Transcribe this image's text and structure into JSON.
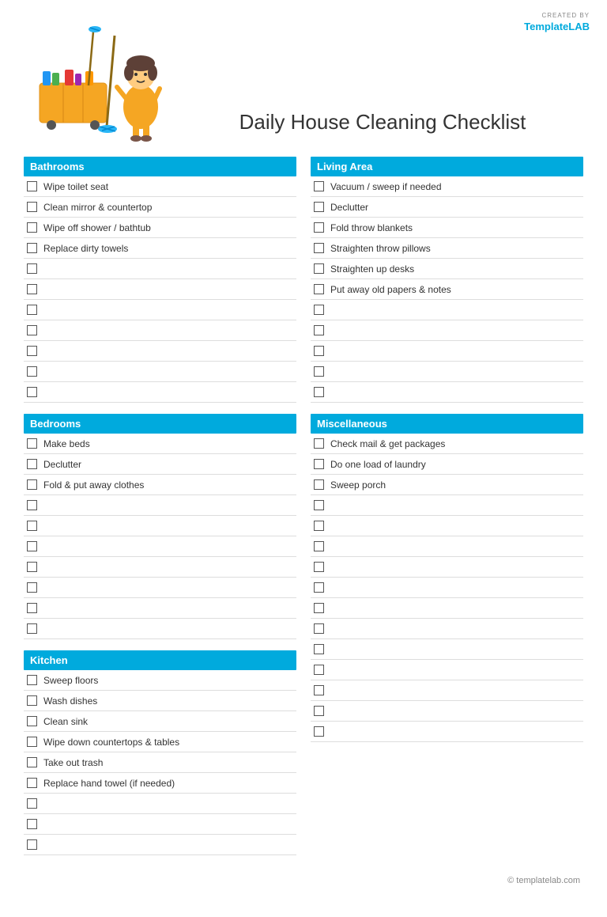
{
  "logo": {
    "created_by": "CREATED BY",
    "template": "Template",
    "lab": "LAB"
  },
  "title": "Daily House Cleaning Checklist",
  "sections": {
    "bathrooms": {
      "label": "Bathrooms",
      "items": [
        "Wipe toilet seat",
        "Clean mirror & countertop",
        "Wipe off shower / bathtub",
        "Replace dirty towels"
      ],
      "empty_rows": 7
    },
    "living_area": {
      "label": "Living Area",
      "items": [
        "Vacuum / sweep if needed",
        "Declutter",
        "Fold throw blankets",
        "Straighten throw pillows",
        "Straighten up desks",
        "Put away old papers & notes"
      ],
      "empty_rows": 5
    },
    "bedrooms": {
      "label": "Bedrooms",
      "items": [
        "Make beds",
        "Declutter",
        "Fold & put away clothes"
      ],
      "empty_rows": 7
    },
    "miscellaneous": {
      "label": "Miscellaneous",
      "items": [
        "Check mail & get packages",
        "Do one load of laundry",
        "Sweep porch"
      ],
      "empty_rows": 12
    },
    "kitchen": {
      "label": "Kitchen",
      "items": [
        "Sweep floors",
        "Wash dishes",
        "Clean sink",
        "Wipe down countertops & tables",
        "Take out trash",
        "Replace hand towel (if needed)"
      ],
      "empty_rows": 3
    }
  },
  "footer": "© templatelab.com"
}
